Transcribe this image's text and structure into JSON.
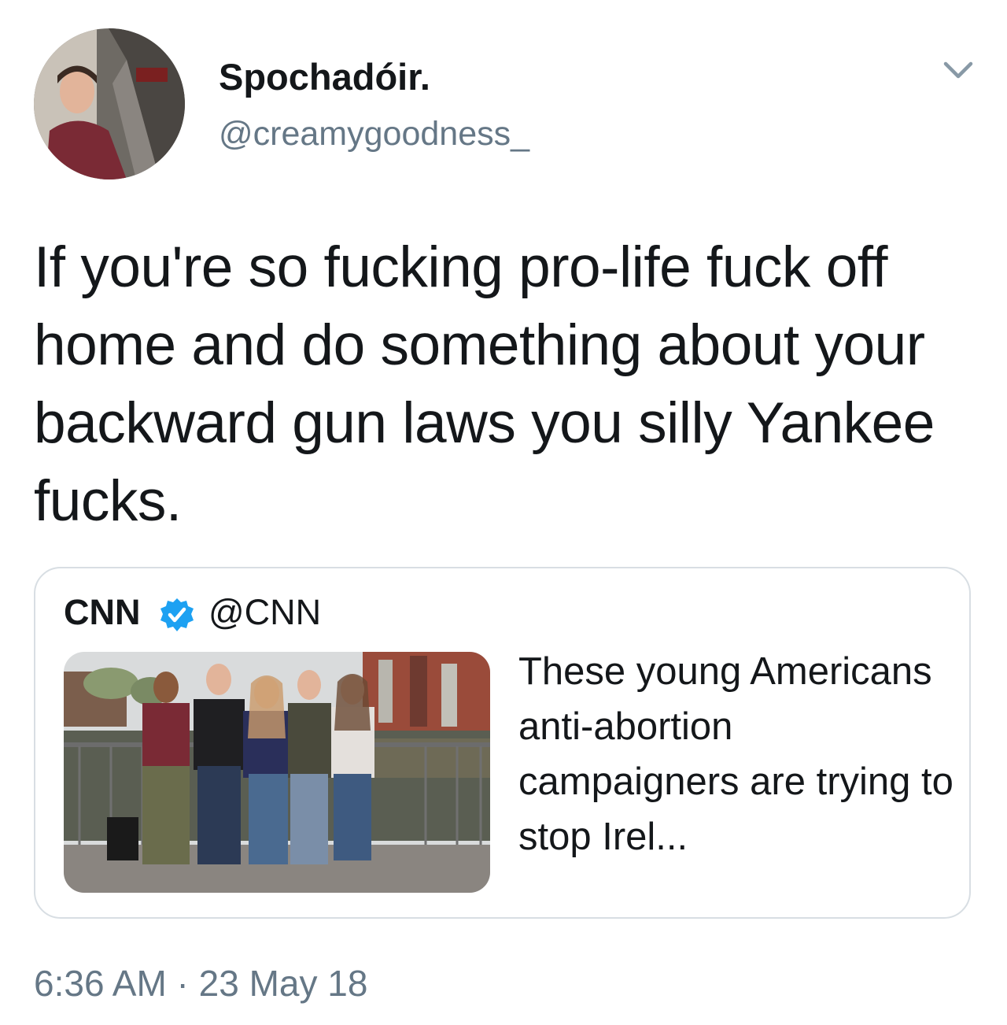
{
  "author": {
    "display_name": "Spochadóir.",
    "handle": "@creamygoodness_",
    "avatar": "avatar-photo"
  },
  "menu": {
    "icon": "chevron-down-icon"
  },
  "tweet": {
    "text": "If you're so fucking pro-life fuck off home and do something about your backward gun laws you silly Yankee fucks."
  },
  "quoted_tweet": {
    "name": "CNN",
    "verified_icon": "verified-badge-icon",
    "handle": "@CNN",
    "image": "photo-five-people-on-bridge",
    "text": "These young Americans anti-abortion campaigners are trying to stop Irel..."
  },
  "meta": {
    "timestamp": "6:36 AM · 23 May 18"
  },
  "colors": {
    "text_primary": "#14171a",
    "text_secondary": "#657786",
    "border": "#d8dee3",
    "verified_blue": "#1da1f2"
  }
}
